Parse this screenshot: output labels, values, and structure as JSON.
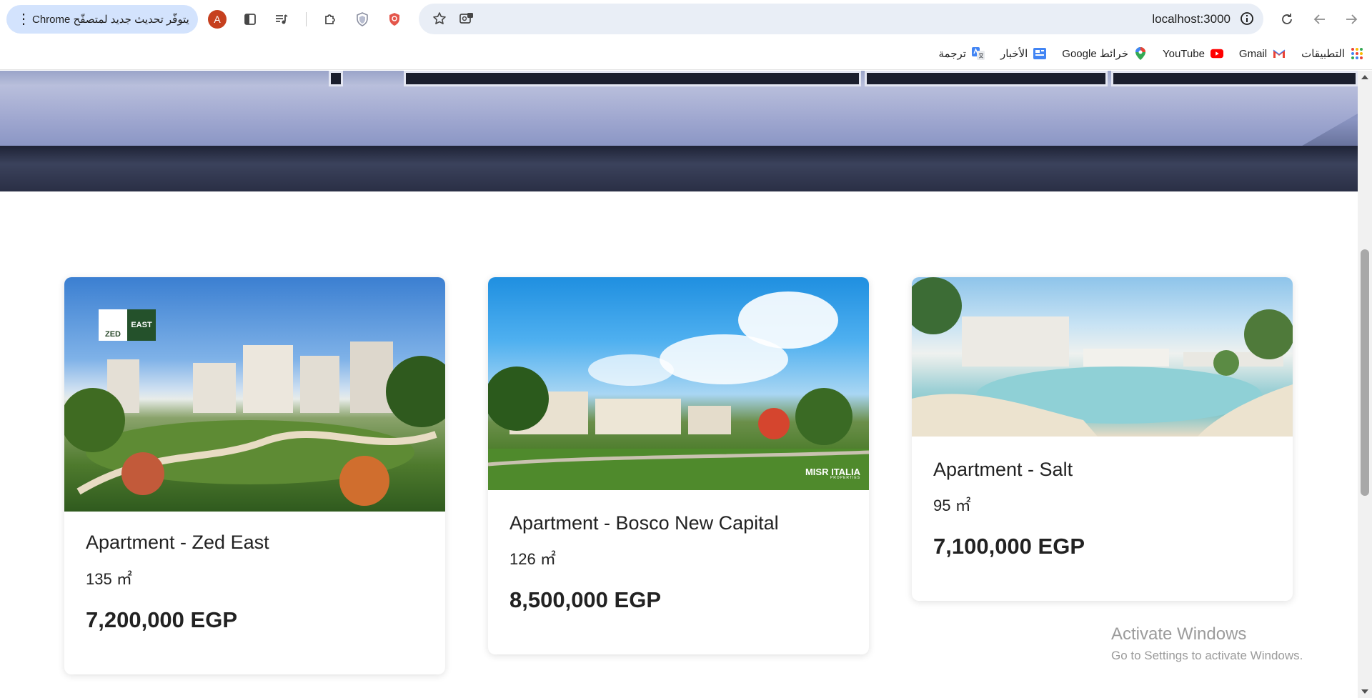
{
  "browser": {
    "update_notice": "يتوفّر تحديث جديد لمتصفّح Chrome",
    "profile_initial": "A",
    "url": "localhost:3000",
    "colors": {
      "pill": "#d3e3fd",
      "omnibox": "#e9eef6",
      "avatar": "#c6401f"
    },
    "icons": [
      "more-vert-icon",
      "side-panel-icon",
      "media-controls-icon",
      "extensions-icon",
      "shield-icon",
      "brave-shield-icon",
      "bookmark-star-icon",
      "lens-icon",
      "site-info-icon",
      "reload-icon",
      "back-icon",
      "forward-icon"
    ]
  },
  "bookmarks": [
    {
      "label": "التطبيقات",
      "icon": "apps-grid-icon"
    },
    {
      "label": "Gmail",
      "icon": "gmail-icon"
    },
    {
      "label": "YouTube",
      "icon": "youtube-icon"
    },
    {
      "label": "خرائط Google",
      "icon": "maps-icon"
    },
    {
      "label": "الأخبار",
      "icon": "news-icon"
    },
    {
      "label": "ترجمة",
      "icon": "translate-icon"
    }
  ],
  "listings": [
    {
      "title": "Apartment - Zed East",
      "area": "135 ㎡",
      "price": "7,200,000 EGP",
      "logo": {
        "line1": "ZED",
        "line2": "EAST"
      }
    },
    {
      "title": "Apartment - Bosco New Capital",
      "area": "126 ㎡",
      "price": "8,500,000 EGP",
      "logo": {
        "line1": "MISR ITALIA",
        "line2": "PROPERTIES"
      }
    },
    {
      "title": "Apartment - Salt",
      "area": "95 ㎡",
      "price": "7,100,000 EGP"
    }
  ],
  "watermark": {
    "line1": "Activate Windows",
    "line2": "Go to Settings to activate Windows."
  }
}
